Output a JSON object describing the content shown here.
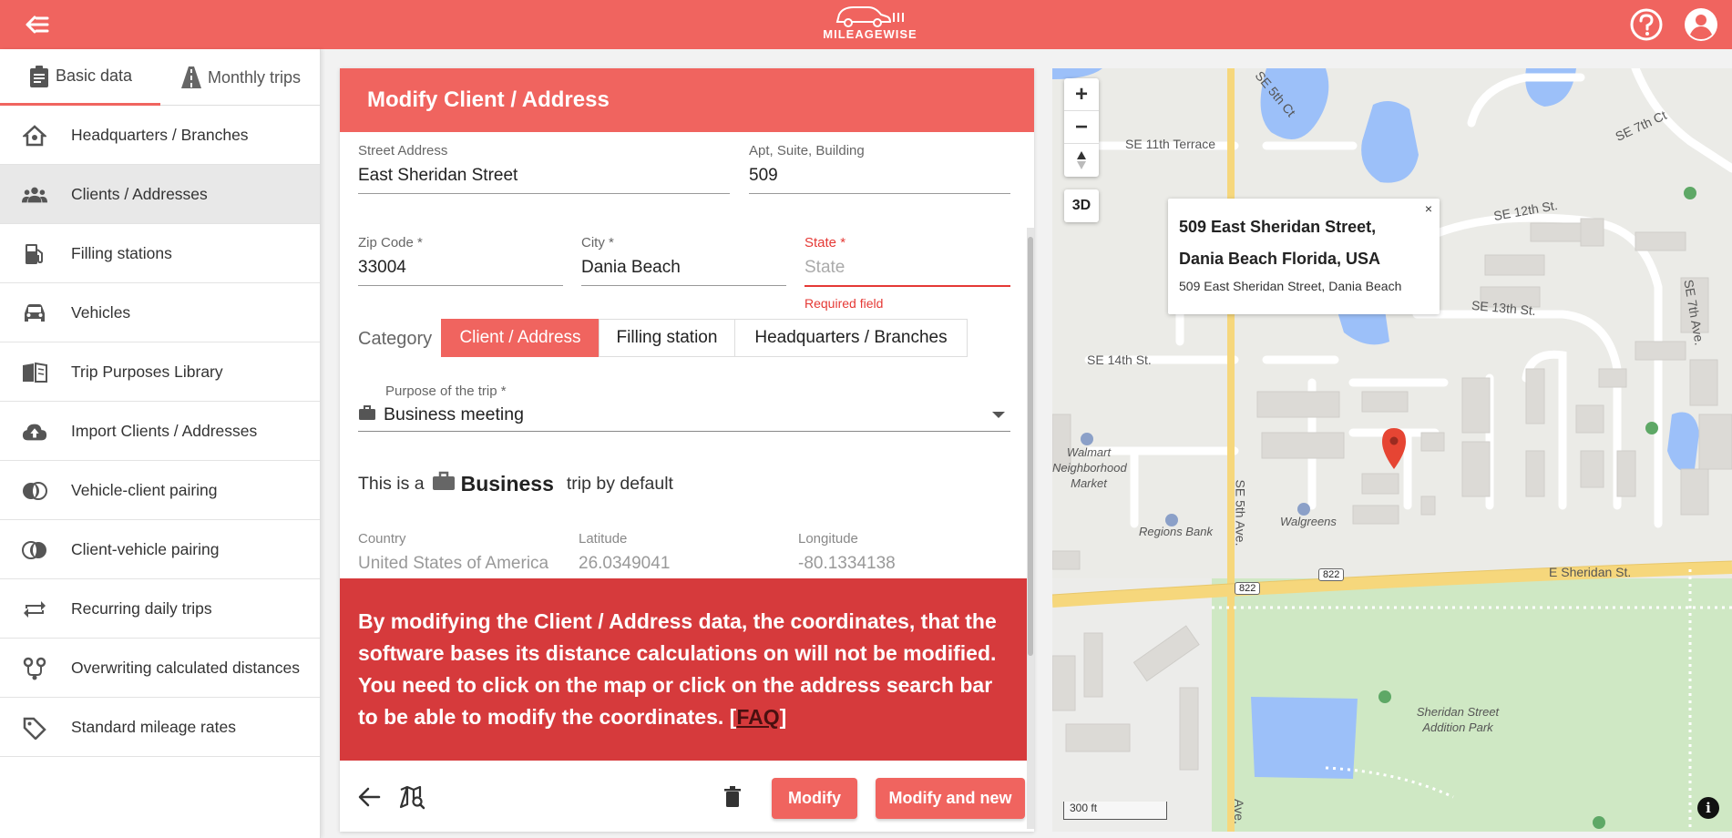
{
  "app": {
    "brand": "MILEAGEWISE"
  },
  "sidebar": {
    "tabs": [
      {
        "label": "Basic data"
      },
      {
        "label": "Monthly trips"
      }
    ],
    "items": [
      {
        "label": "Headquarters / Branches"
      },
      {
        "label": "Clients / Addresses"
      },
      {
        "label": "Filling stations"
      },
      {
        "label": "Vehicles"
      },
      {
        "label": "Trip Purposes Library"
      },
      {
        "label": "Import Clients / Addresses"
      },
      {
        "label": "Vehicle-client pairing"
      },
      {
        "label": "Client-vehicle pairing"
      },
      {
        "label": "Recurring daily trips"
      },
      {
        "label": "Overwriting calculated distances"
      },
      {
        "label": "Standard mileage rates"
      }
    ]
  },
  "form": {
    "title": "Modify Client / Address",
    "street": {
      "label": "Street Address",
      "value": "East Sheridan Street"
    },
    "apt": {
      "label": "Apt, Suite, Building",
      "value": "509"
    },
    "zip": {
      "label": "Zip Code *",
      "value": "33004"
    },
    "city": {
      "label": "City *",
      "value": "Dania Beach"
    },
    "state": {
      "label": "State *",
      "placeholder": "State",
      "error": "Required field"
    },
    "category_label": "Category",
    "categories": [
      "Client / Address",
      "Filling station",
      "Headquarters / Branches"
    ],
    "selected_category": "Client / Address",
    "purpose": {
      "label": "Purpose of the trip *",
      "value": "Business meeting"
    },
    "default_prefix": "This is a",
    "default_type": "Business",
    "default_suffix": "trip by default",
    "country": {
      "label": "Country",
      "value": "United States of America"
    },
    "latitude": {
      "label": "Latitude",
      "value": "26.0349041"
    },
    "longitude": {
      "label": "Longitude",
      "value": "-80.1334138"
    },
    "warning_text": "By modifying the Client / Address data, the coordinates, that the software bases its distance calculations on will not be modified. You need to click on the map or click on the address search bar to be able to modify the coordinates. [",
    "warning_link": "FAQ",
    "warning_end": "]",
    "buttons": {
      "modify": "Modify",
      "modify_new": "Modify and new"
    }
  },
  "map": {
    "btn_3d": "3D",
    "zoom_in": "+",
    "zoom_out": "−",
    "popup_title_1": "509 East Sheridan Street,",
    "popup_title_2": "Dania Beach Florida, USA",
    "popup_sub": "509 East Sheridan Street, Dania Beach",
    "popup_close": "×",
    "scale": "300 ft",
    "info": "i",
    "labels": {
      "se11": "SE 11th Terrace",
      "se5ct": "SE 5th Ct",
      "se7ct": "SE 7th Ct",
      "se12": "SE 12th St.",
      "se13": "SE 13th St.",
      "se14": "SE 14th St.",
      "se7ave": "SE 7th Ave.",
      "se5ave": "SE 5th Ave.",
      "ave": "Ave.",
      "sheridan": "E Sheridan St.",
      "walmart": "Walmart Neighborhood Market",
      "regions": "Regions Bank",
      "walgreens": "Walgreens",
      "park": "Sheridan Street Addition Park",
      "route1": "822",
      "route2": "822"
    }
  }
}
